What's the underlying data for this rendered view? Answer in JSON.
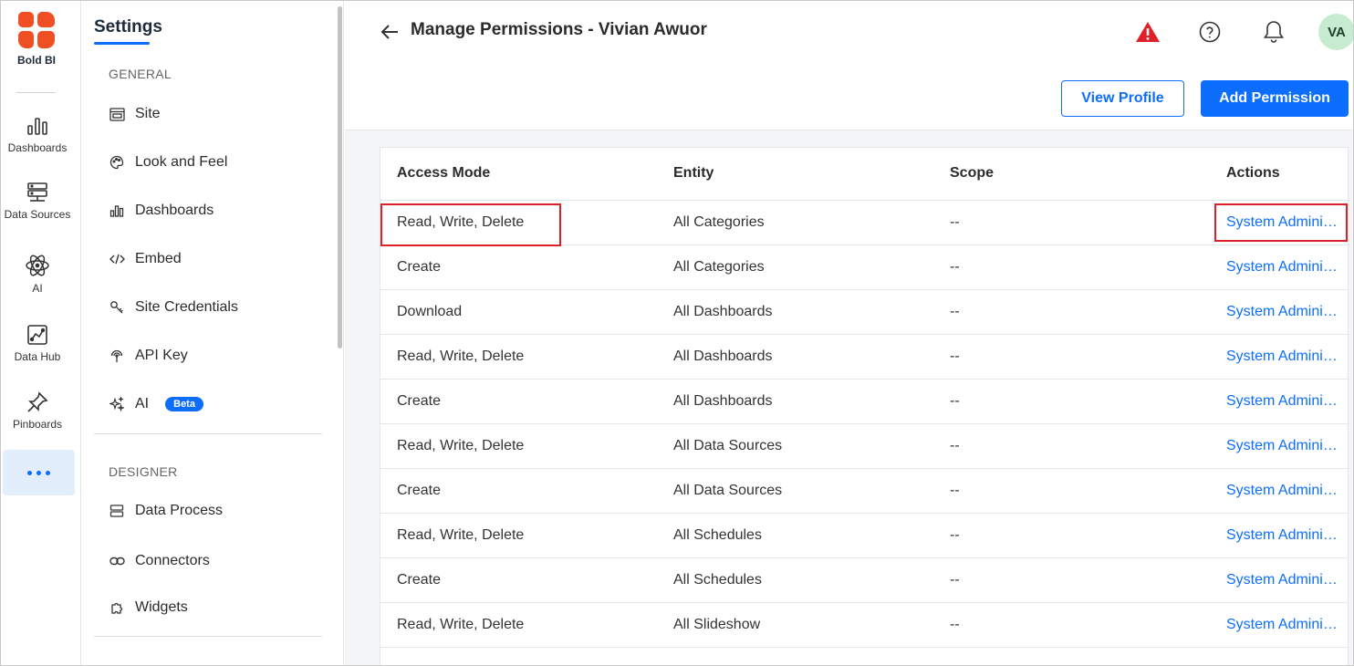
{
  "brand": {
    "name": "Bold BI",
    "logo_color": "#f04e23"
  },
  "rail": {
    "items": [
      {
        "label": "Dashboards",
        "icon": "bar-chart-icon"
      },
      {
        "label": "Data Sources",
        "icon": "server-icon"
      },
      {
        "label": "AI",
        "icon": "atom-icon"
      },
      {
        "label": "Data Hub",
        "icon": "data-hub-icon"
      },
      {
        "label": "Pinboards",
        "icon": "pin-icon"
      }
    ],
    "more_icon": "more-dots-icon"
  },
  "settings": {
    "title": "Settings",
    "general_label": "GENERAL",
    "general_items": [
      {
        "label": "Site",
        "icon": "site-icon"
      },
      {
        "label": "Look and Feel",
        "icon": "palette-icon"
      },
      {
        "label": "Dashboards",
        "icon": "bar-chart-icon"
      },
      {
        "label": "Embed",
        "icon": "code-icon"
      },
      {
        "label": "Site Credentials",
        "icon": "key-icon"
      },
      {
        "label": "API Key",
        "icon": "api-key-icon"
      },
      {
        "label": "AI",
        "icon": "sparkle-icon",
        "badge": "Beta"
      }
    ],
    "designer_label": "DESIGNER",
    "designer_items": [
      {
        "label": "Data Process",
        "icon": "data-process-icon"
      },
      {
        "label": "Connectors",
        "icon": "link-icon"
      },
      {
        "label": "Widgets",
        "icon": "widgets-icon"
      }
    ]
  },
  "header": {
    "title": "Manage Permissions - Vivian Awuor",
    "avatar_initials": "VA",
    "view_profile_label": "View Profile",
    "add_permission_label": "Add Permission",
    "accent_color": "#0d6efd",
    "warning_color": "#e01f26"
  },
  "table": {
    "columns": [
      "Access Mode",
      "Entity",
      "Scope",
      "Actions"
    ],
    "rows": [
      {
        "access": "Read, Write, Delete",
        "entity": "All Categories",
        "scope": "--",
        "action": "System Administrator"
      },
      {
        "access": "Create",
        "entity": "All Categories",
        "scope": "--",
        "action": "System Administrator"
      },
      {
        "access": "Download",
        "entity": "All Dashboards",
        "scope": "--",
        "action": "System Administrator"
      },
      {
        "access": "Read, Write, Delete",
        "entity": "All Dashboards",
        "scope": "--",
        "action": "System Administrator"
      },
      {
        "access": "Create",
        "entity": "All Dashboards",
        "scope": "--",
        "action": "System Administrator"
      },
      {
        "access": "Read, Write, Delete",
        "entity": "All Data Sources",
        "scope": "--",
        "action": "System Administrator"
      },
      {
        "access": "Create",
        "entity": "All Data Sources",
        "scope": "--",
        "action": "System Administrator"
      },
      {
        "access": "Read, Write, Delete",
        "entity": "All Schedules",
        "scope": "--",
        "action": "System Administrator"
      },
      {
        "access": "Create",
        "entity": "All Schedules",
        "scope": "--",
        "action": "System Administrator"
      },
      {
        "access": "Read, Write, Delete",
        "entity": "All Slideshow",
        "scope": "--",
        "action": "System Administrator"
      }
    ]
  }
}
